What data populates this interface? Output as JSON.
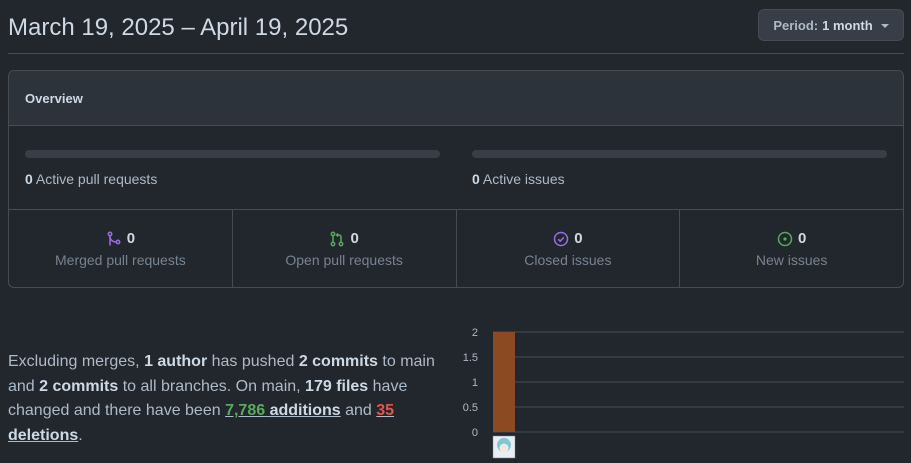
{
  "header": {
    "date_range": "March 19, 2025 – April 19, 2025",
    "period_prefix": "Period:",
    "period_value": "1 month"
  },
  "overview": {
    "title": "Overview",
    "active_pull_requests": {
      "count": "0",
      "label": "Active pull requests"
    },
    "active_issues": {
      "count": "0",
      "label": "Active issues"
    },
    "stats": [
      {
        "count": "0",
        "label": "Merged pull requests",
        "icon": "git-merge-icon",
        "color": "#986ee2"
      },
      {
        "count": "0",
        "label": "Open pull requests",
        "icon": "git-pull-request-icon",
        "color": "#57ab5a"
      },
      {
        "count": "0",
        "label": "Closed issues",
        "icon": "issue-closed-icon",
        "color": "#986ee2"
      },
      {
        "count": "0",
        "label": "New issues",
        "icon": "issue-opened-icon",
        "color": "#57ab5a"
      }
    ]
  },
  "summary": {
    "t1": "Excluding merges, ",
    "authors": "1 author",
    "t2": " has pushed ",
    "commits_main": "2 commits",
    "t3": " to main and ",
    "commits_all": "2 commits",
    "t4": " to all branches. On main, ",
    "files": "179 files",
    "t5": " have changed and there have been ",
    "additions_num": "7,786",
    "additions_word": " additions",
    "t6": " and ",
    "deletions_num": "35",
    "deletions_word": " deletions",
    "t7": "."
  },
  "chart_data": {
    "type": "bar",
    "categories": [
      "contributor-1"
    ],
    "values": [
      2
    ],
    "ylim": [
      0,
      2
    ],
    "yticks": [
      "2",
      "1.5",
      "1",
      "0.5",
      "0"
    ],
    "bar_color": "#8b4a22",
    "grid": true
  }
}
